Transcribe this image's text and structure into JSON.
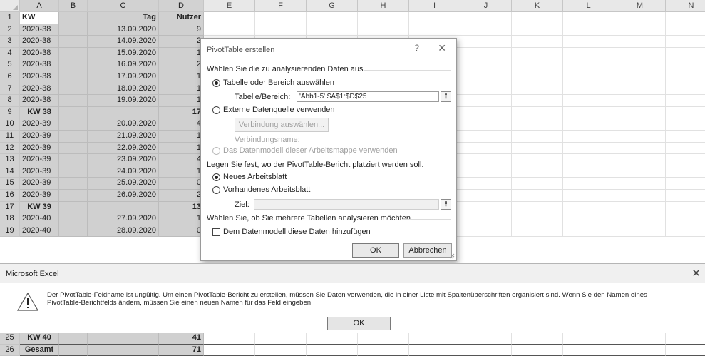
{
  "columns": [
    "A",
    "B",
    "C",
    "D",
    "E",
    "F",
    "G",
    "H",
    "I",
    "J",
    "K",
    "L",
    "M",
    "N"
  ],
  "rows": [
    {
      "n": "1",
      "a": "KW",
      "c": "Tag",
      "d": "Nutzer",
      "kind": "header"
    },
    {
      "n": "2",
      "a": "2020-38",
      "c": "13.09.2020",
      "d": "9"
    },
    {
      "n": "3",
      "a": "2020-38",
      "c": "14.09.2020",
      "d": "2"
    },
    {
      "n": "4",
      "a": "2020-38",
      "c": "15.09.2020",
      "d": "1"
    },
    {
      "n": "5",
      "a": "2020-38",
      "c": "16.09.2020",
      "d": "2"
    },
    {
      "n": "6",
      "a": "2020-38",
      "c": "17.09.2020",
      "d": "1"
    },
    {
      "n": "7",
      "a": "2020-38",
      "c": "18.09.2020",
      "d": "1"
    },
    {
      "n": "8",
      "a": "2020-38",
      "c": "19.09.2020",
      "d": "1"
    },
    {
      "n": "9",
      "a": "KW 38",
      "c": "",
      "d": "17",
      "kind": "sum"
    },
    {
      "n": "10",
      "a": "2020-39",
      "c": "20.09.2020",
      "d": "4"
    },
    {
      "n": "11",
      "a": "2020-39",
      "c": "21.09.2020",
      "d": "1"
    },
    {
      "n": "12",
      "a": "2020-39",
      "c": "22.09.2020",
      "d": "1"
    },
    {
      "n": "13",
      "a": "2020-39",
      "c": "23.09.2020",
      "d": "4"
    },
    {
      "n": "14",
      "a": "2020-39",
      "c": "24.09.2020",
      "d": "1"
    },
    {
      "n": "15",
      "a": "2020-39",
      "c": "25.09.2020",
      "d": "0"
    },
    {
      "n": "16",
      "a": "2020-39",
      "c": "26.09.2020",
      "d": "2"
    },
    {
      "n": "17",
      "a": "KW 39",
      "c": "",
      "d": "13",
      "kind": "sum"
    },
    {
      "n": "18",
      "a": "2020-40",
      "c": "27.09.2020",
      "d": "1"
    },
    {
      "n": "19",
      "a": "2020-40",
      "c": "28.09.2020",
      "d": "0"
    }
  ],
  "bottom_rows": [
    {
      "n": "25",
      "a": "KW 40",
      "d": "41",
      "kind": "sum"
    },
    {
      "n": "26",
      "a": "Gesamt",
      "d": "71",
      "kind": "sum"
    }
  ],
  "pivot_dialog": {
    "title": "PivotTable erstellen",
    "help": "?",
    "close": "✕",
    "section1": "Wählen Sie die zu analysierenden Daten aus.",
    "opt_table": "Tabelle oder Bereich auswählen",
    "range_label": "Tabelle/Bereich:",
    "range_value": "'Abb1-5'!$A$1:$D$25",
    "opt_external": "Externe Datenquelle verwenden",
    "choose_conn": "Verbindung auswählen...",
    "conn_name": "Verbindungsname:",
    "opt_datamodel": "Das Datenmodell dieser Arbeitsmappe verwenden",
    "section2": "Legen Sie fest, wo der PivotTable-Bericht platziert werden soll.",
    "opt_new": "Neues Arbeitsblatt",
    "opt_existing": "Vorhandenes Arbeitsblatt",
    "target_label": "Ziel:",
    "target_value": "",
    "section3": "Wählen Sie, ob Sie mehrere Tabellen analysieren möchten.",
    "chk_datamodel": "Dem Datenmodell diese Daten hinzufügen",
    "ok": "OK",
    "cancel": "Abbrechen",
    "picker": "⭱"
  },
  "message_box": {
    "title": "Microsoft Excel",
    "close": "✕",
    "line1": "Der PivotTable-Feldname ist ungültig. Um einen PivotTable-Bericht zu erstellen, müssen Sie Daten verwenden, die in einer Liste mit Spaltenüberschriften organisiert sind. Wenn Sie den Namen eines",
    "line2": "PivotTable-Berichtfelds ändern, müssen Sie einen neuen Namen für das Feld eingeben.",
    "ok": "OK"
  }
}
